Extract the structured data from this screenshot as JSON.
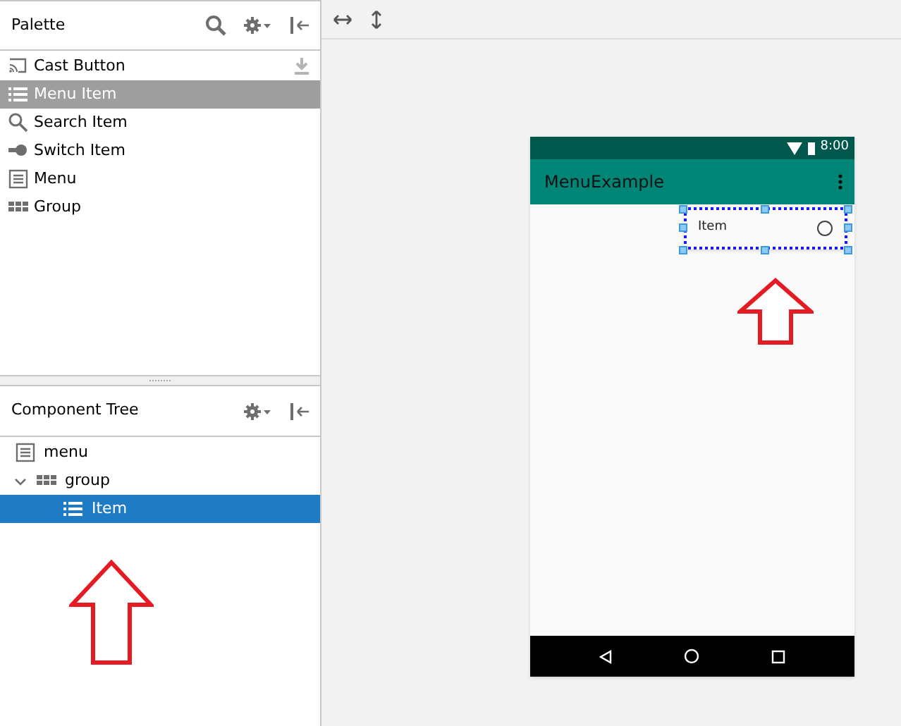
{
  "palette": {
    "title": "Palette",
    "items": [
      {
        "label": "Cast Button",
        "kind": "cast",
        "selected": false,
        "download": true
      },
      {
        "label": "Menu Item",
        "kind": "list",
        "selected": true,
        "download": false
      },
      {
        "label": "Search Item",
        "kind": "search",
        "selected": false,
        "download": false
      },
      {
        "label": "Switch Item",
        "kind": "switch",
        "selected": false,
        "download": false
      },
      {
        "label": "Menu",
        "kind": "menu",
        "selected": false,
        "download": false
      },
      {
        "label": "Group",
        "kind": "grid",
        "selected": false,
        "download": false
      }
    ]
  },
  "component_tree": {
    "title": "Component Tree",
    "items": [
      {
        "label": "menu",
        "kind": "menu",
        "selected": false
      },
      {
        "label": "group",
        "kind": "grid",
        "selected": false,
        "expanded": true,
        "children": [
          {
            "label": "Item",
            "kind": "list",
            "selected": true
          }
        ]
      }
    ]
  },
  "preview": {
    "status_time": "8:00",
    "app_title": "MenuExample",
    "menu_item": {
      "label": "Item",
      "checked": false
    }
  }
}
